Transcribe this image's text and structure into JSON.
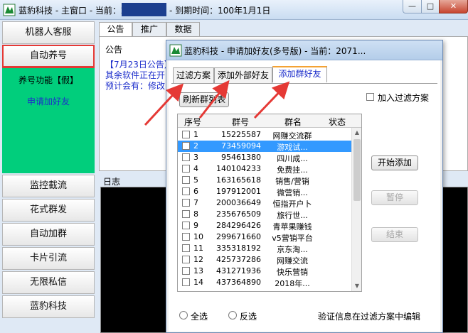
{
  "main_window": {
    "title_left": "蓝豹科技 - 主窗口 - 当前：2",
    "title_right": "- 到期时间：100年1月1日",
    "min_glyph": "—",
    "max_glyph": "□",
    "close_glyph": "✕"
  },
  "sidebar": {
    "top_buttons": [
      "机器人客服",
      "自动养号"
    ],
    "panel_title": "养号功能【假】",
    "panel_link": "申请加好友",
    "bottom_buttons": [
      "监控截流",
      "花式群发",
      "自动加群",
      "卡片引流",
      "无限私信",
      "蓝豹科技"
    ]
  },
  "main_tabs": [
    "公告",
    "推广",
    "数据"
  ],
  "notice": {
    "title": "公告",
    "lines": [
      "【7月23日公告】",
      "其余软件正在开",
      "预计会有：修改"
    ]
  },
  "log_title": "日志",
  "dialog": {
    "title": "蓝豹科技 - 申请加好友(多号版) - 当前：2071...",
    "tabs": [
      "过滤方案",
      "添加外部好友",
      "添加群好友"
    ],
    "refresh_button": "刷新群列表",
    "filter_checkbox_label": "加入过滤方案",
    "columns": [
      "序号",
      "群号",
      "群名",
      "状态"
    ],
    "rows": [
      {
        "no": "1",
        "group_id": "15225587",
        "group_name": "网赚交流群"
      },
      {
        "no": "2",
        "group_id": "73459094",
        "group_name": "游戏试..."
      },
      {
        "no": "3",
        "group_id": "95461380",
        "group_name": "四川成..."
      },
      {
        "no": "4",
        "group_id": "140104233",
        "group_name": "免费挂..."
      },
      {
        "no": "5",
        "group_id": "163165618",
        "group_name": "销售/营销"
      },
      {
        "no": "6",
        "group_id": "197912001",
        "group_name": "微营销..."
      },
      {
        "no": "7",
        "group_id": "200036649",
        "group_name": "恒指开户卜"
      },
      {
        "no": "8",
        "group_id": "235676509",
        "group_name": "旅行世..."
      },
      {
        "no": "9",
        "group_id": "284296426",
        "group_name": "青苹果赚钱"
      },
      {
        "no": "10",
        "group_id": "299671660",
        "group_name": "v5营销平台"
      },
      {
        "no": "11",
        "group_id": "335318192",
        "group_name": "京东淘..."
      },
      {
        "no": "12",
        "group_id": "425737286",
        "group_name": "网赚交流"
      },
      {
        "no": "13",
        "group_id": "431271936",
        "group_name": "快乐营销"
      },
      {
        "no": "14",
        "group_id": "437364890",
        "group_name": "2018年..."
      }
    ],
    "selected_row_index": 1,
    "buttons": {
      "start": "开始添加",
      "pause": "暂停",
      "stop": "结束"
    },
    "select_all": "全选",
    "invert_select": "反选",
    "footnote": "验证信息在过滤方案中编辑"
  },
  "colors": {
    "sidebar_panel": "#01ce7c",
    "highlight_red": "#e53935",
    "link_blue": "#1d2ecb",
    "selection_blue": "#3399ff"
  }
}
